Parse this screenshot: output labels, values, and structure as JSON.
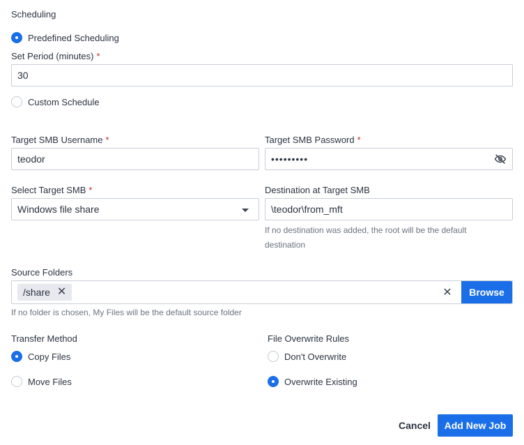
{
  "scheduling": {
    "title": "Scheduling",
    "predefined_label": "Predefined Scheduling",
    "period_label": "Set Period (minutes)",
    "period_value": "30",
    "custom_label": "Custom Schedule",
    "required_mark": "*"
  },
  "smb": {
    "username_label": "Target SMB Username",
    "username_value": "teodor",
    "password_label": "Target SMB Password",
    "password_value": "•••••••••",
    "select_label": "Select Target SMB",
    "select_value": "Windows file share",
    "destination_label": "Destination at Target SMB",
    "destination_value": "\\teodor\\from_mft",
    "destination_help_line1": "If no destination was added, the root will be the default",
    "destination_help_line2": "destination"
  },
  "source": {
    "label": "Source Folders",
    "chips": [
      "/share"
    ],
    "browse_label": "Browse",
    "help": "If no folder is chosen, My Files will be the default source folder"
  },
  "transfer": {
    "title": "Transfer Method",
    "options": [
      {
        "label": "Copy Files",
        "checked": true
      },
      {
        "label": "Move Files",
        "checked": false
      }
    ]
  },
  "overwrite": {
    "title": "File Overwrite Rules",
    "options": [
      {
        "label": "Don't Overwrite",
        "checked": false
      },
      {
        "label": "Overwrite Existing",
        "checked": true
      }
    ]
  },
  "footer": {
    "cancel_label": "Cancel",
    "submit_label": "Add New Job"
  },
  "icons": {
    "password_toggle": "eye-off-icon",
    "clear": "close-icon",
    "chip_remove": "close-icon",
    "select": "caret-down-icon"
  },
  "colors": {
    "accent": "#1a6fe8",
    "required": "#c62828",
    "text": "#2b3340",
    "help_text": "#6b7480",
    "border": "#c9ced6"
  }
}
